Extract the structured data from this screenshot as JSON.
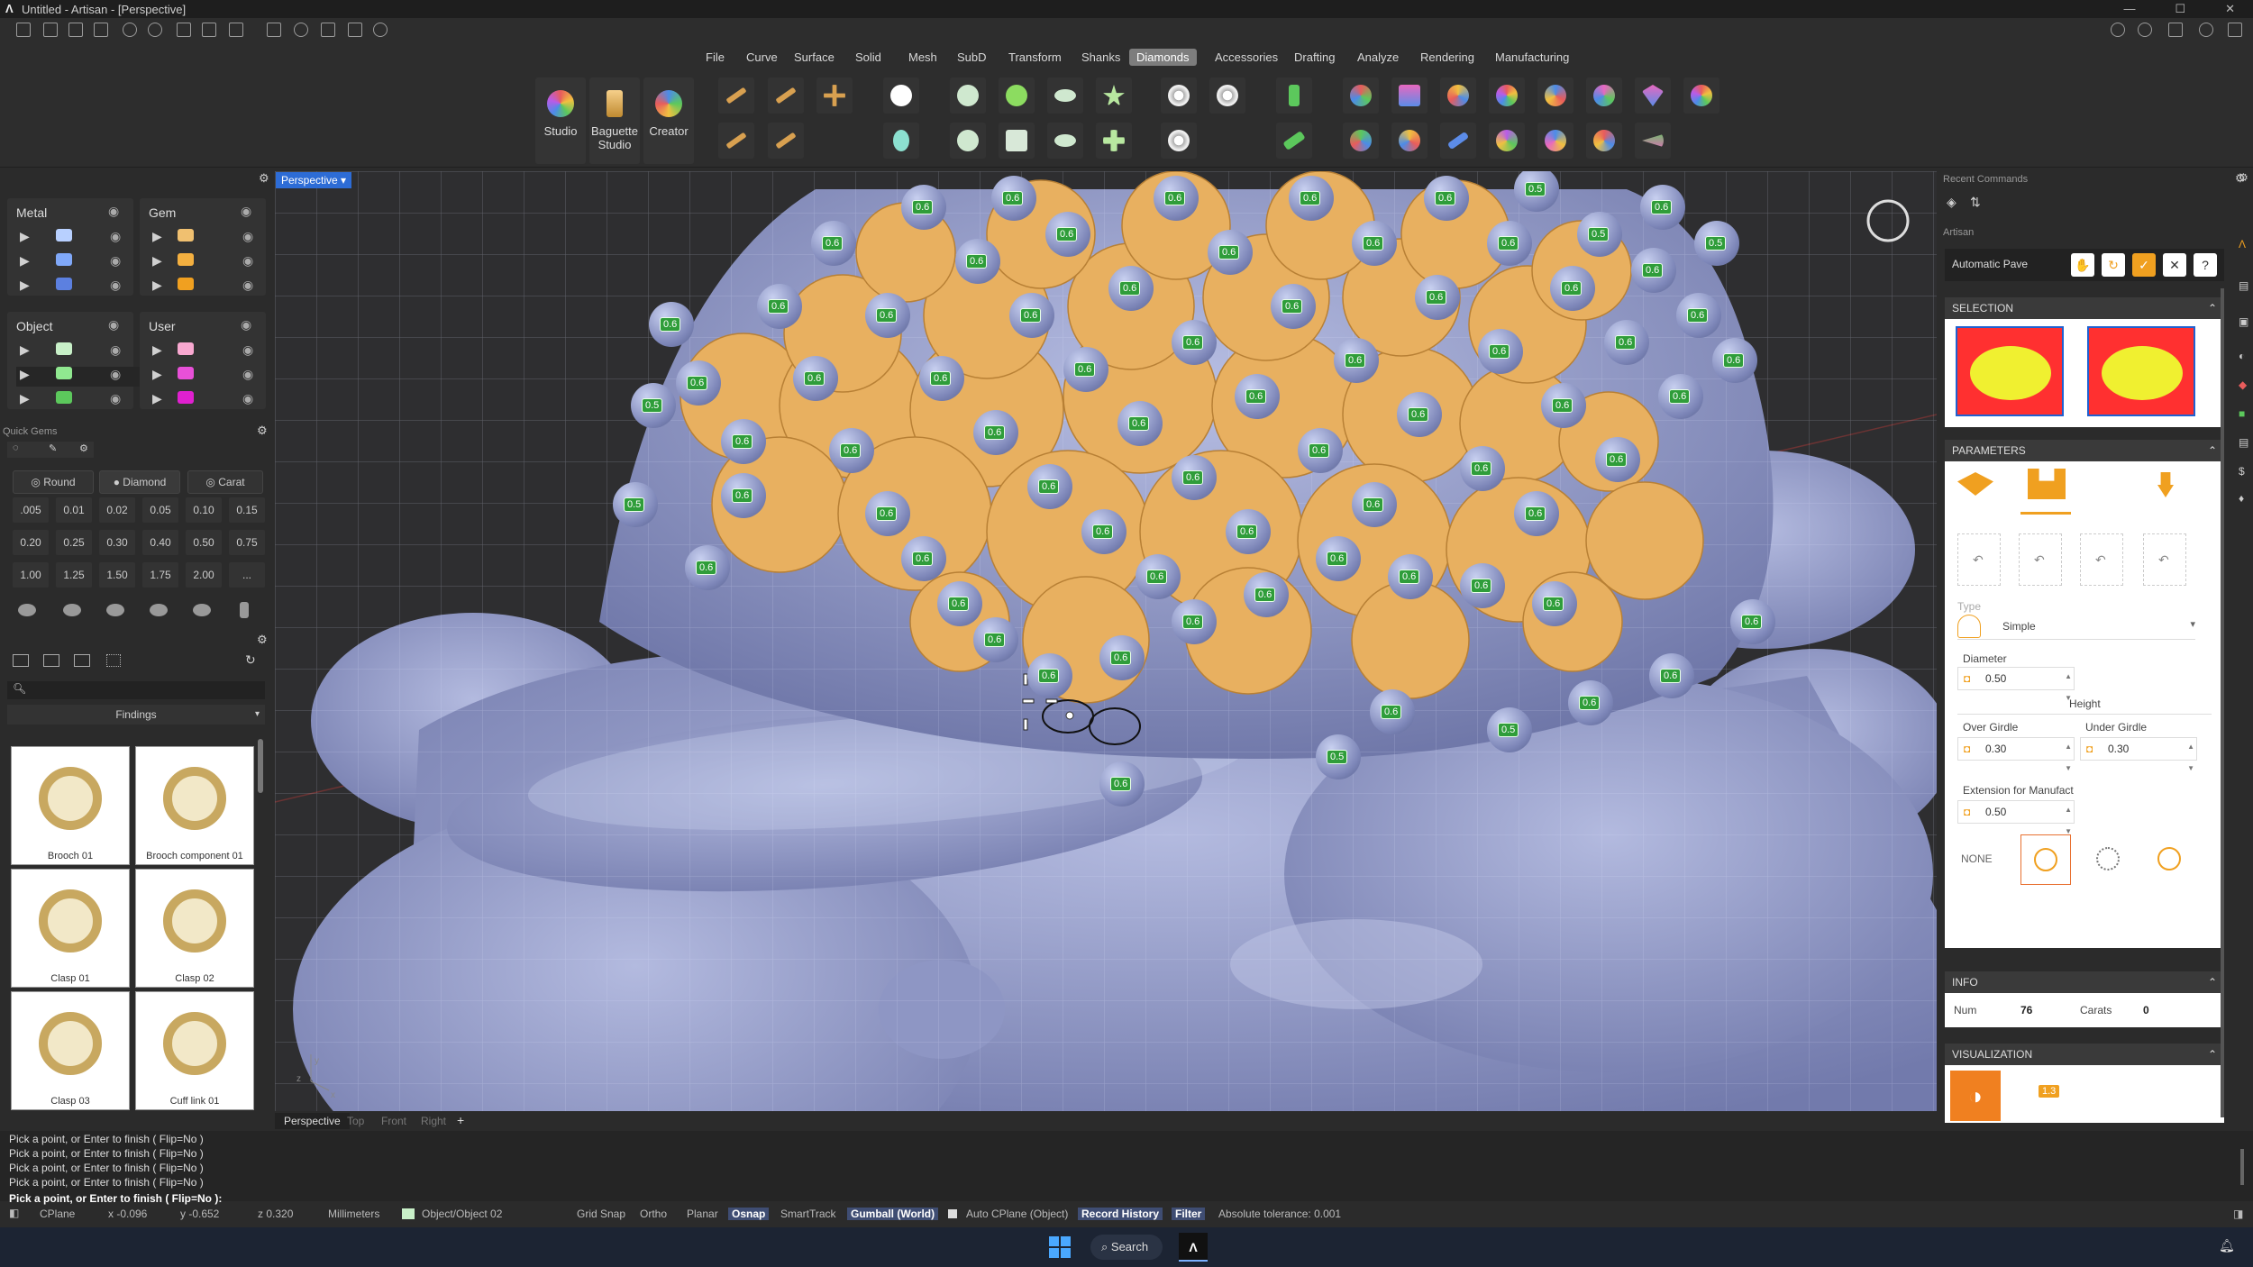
{
  "window": {
    "title": "Untitled - Artisan - [Perspective]"
  },
  "menus": [
    "File",
    "Curve",
    "Surface",
    "Solid",
    "Mesh",
    "SubD",
    "Transform",
    "Shanks",
    "Diamonds",
    "Accessories",
    "Drafting",
    "Analyze",
    "Rendering",
    "Manufacturing"
  ],
  "active_menu": "Diamonds",
  "toolbar": {
    "studio": "Studio",
    "baguette": "Baguette Studio",
    "creator": "Creator"
  },
  "layers": {
    "metal": "Metal",
    "gem": "Gem",
    "object": "Object",
    "user": "User"
  },
  "quick_gems": {
    "title": "Quick Gems",
    "round": "Round",
    "diamond": "Diamond",
    "carat": "Carat",
    "sizes": [
      ".005",
      "0.01",
      "0.02",
      "0.05",
      "0.10",
      "0.15",
      "0.20",
      "0.25",
      "0.30",
      "0.40",
      "0.50",
      "0.75",
      "1.00",
      "1.25",
      "1.50",
      "1.75",
      "2.00",
      "..."
    ]
  },
  "findings": {
    "title": "Findings",
    "items": [
      "Brooch 01",
      "Brooch component 01",
      "Clasp 01",
      "Clasp 02",
      "Clasp 03",
      "Cuff link 01"
    ]
  },
  "viewport": {
    "name": "Perspective",
    "tabs": [
      "Perspective",
      "Top",
      "Front",
      "Right"
    ],
    "add_tab": "+"
  },
  "right": {
    "recent": "Recent Commands",
    "artisan": "Artisan",
    "command": "Automatic Pave",
    "selection": "SELECTION",
    "parameters": "PARAMETERS",
    "type_label": "Type",
    "type_value": "Simple",
    "diameter_label": "Diameter",
    "diameter_value": "0.50",
    "height_label": "Height",
    "over_label": "Over Girdle",
    "over_value": "0.30",
    "under_label": "Under Girdle",
    "under_value": "0.30",
    "ext_label": "Extension for Manufact",
    "ext_value": "0.50",
    "none_label": "NONE",
    "info": "INFO",
    "num_label": "Num",
    "num_value": "76",
    "carats_label": "Carats",
    "carats_value": "0",
    "visualization": "VISUALIZATION",
    "vis_badge": "1.3"
  },
  "command_history": [
    "Pick a point, or Enter to finish ( Flip=No )",
    "Pick a point, or Enter to finish ( Flip=No )",
    "Pick a point, or Enter to finish ( Flip=No )",
    "Pick a point, or Enter to finish ( Flip=No )"
  ],
  "command_prompt": "Pick a point, or Enter to finish ( Flip=No ):",
  "status": {
    "cplane": "CPlane",
    "x": "x -0.096",
    "y": "y -0.652",
    "z": "z 0.320",
    "units": "Millimeters",
    "layer": "Object/Object 02",
    "grid": "Grid Snap",
    "ortho": "Ortho",
    "planar": "Planar",
    "osnap": "Osnap",
    "smarttrack": "SmartTrack",
    "gumball": "Gumball (World)",
    "autocplane": "Auto CPlane (Object)",
    "record": "Record History",
    "filter": "Filter",
    "tolerance": "Absolute tolerance: 0.001"
  },
  "taskbar": {
    "search": "Search"
  },
  "colors": {
    "accent_blue": "#2d6cd6",
    "gem_orange": "#e8b060",
    "gem_label": "#2f9d3a",
    "active_menu": "#7d7d7d"
  }
}
